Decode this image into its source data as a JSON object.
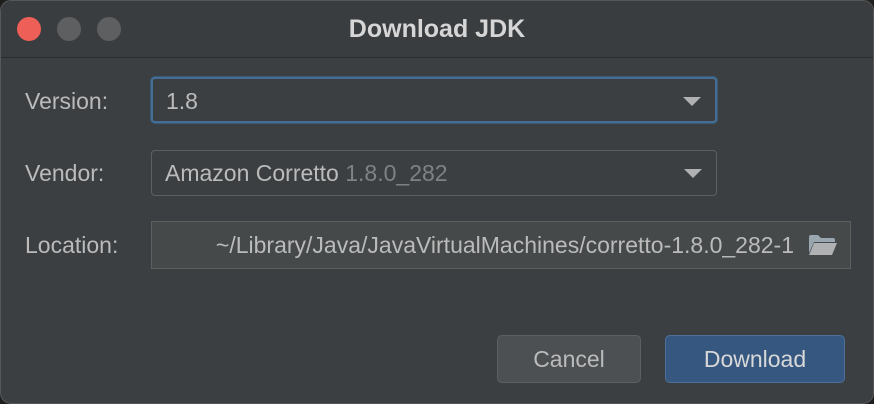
{
  "dialog": {
    "title": "Download JDK"
  },
  "form": {
    "version_label": "Version:",
    "version_value": "1.8",
    "vendor_label": "Vendor:",
    "vendor_name": "Amazon Corretto",
    "vendor_version": " 1.8.0_282",
    "location_label": "Location:",
    "location_value": "~/Library/Java/JavaVirtualMachines/corretto-1.8.0_282-1"
  },
  "buttons": {
    "cancel": "Cancel",
    "download": "Download"
  },
  "icons": {
    "close": "close-icon",
    "minimize": "minimize-icon",
    "maximize": "maximize-icon",
    "dropdown": "chevron-down-icon",
    "folder": "folder-open-icon"
  },
  "colors": {
    "accent": "#365880",
    "focus_border": "#466d94",
    "close_button": "#ee5f57"
  }
}
